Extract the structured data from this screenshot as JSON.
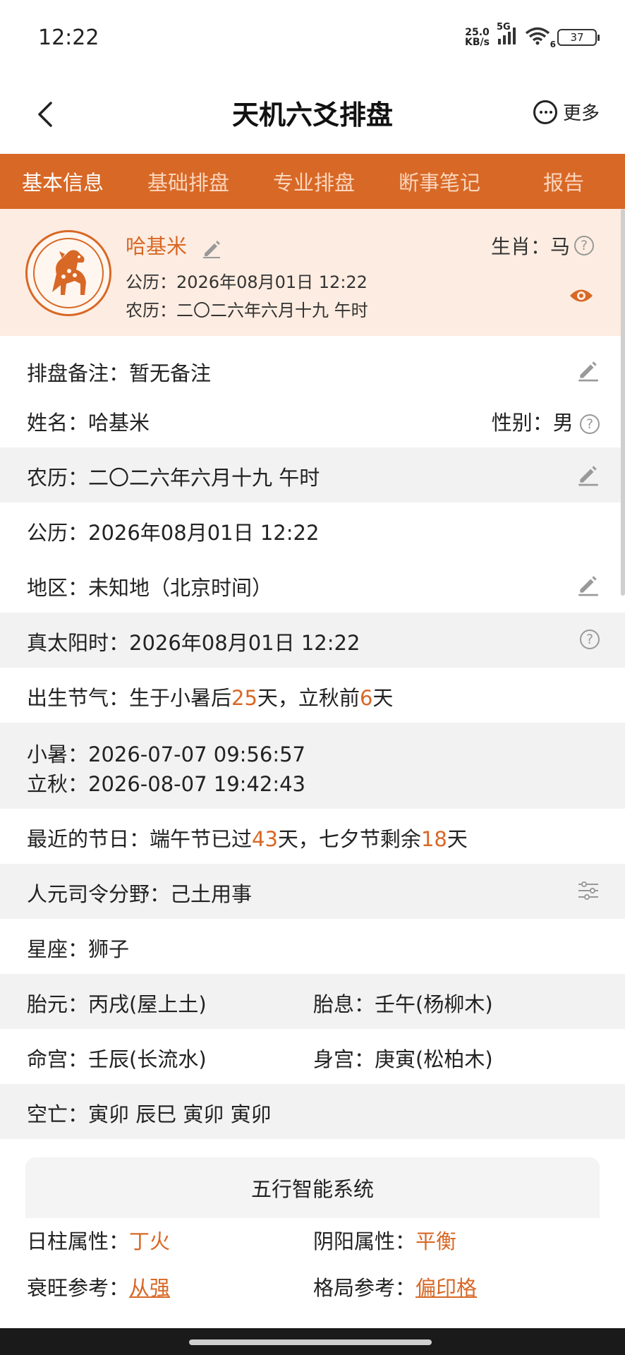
{
  "status": {
    "time": "12:22",
    "net_speed_top": "25.0",
    "net_speed_bottom": "KB/s",
    "network": "5G",
    "wifi_level": "6",
    "battery": "37"
  },
  "header": {
    "title": "天机六爻排盘",
    "more_label": "更多"
  },
  "tabs": [
    {
      "label": "基本信息",
      "active": true
    },
    {
      "label": "基础排盘",
      "active": false
    },
    {
      "label": "专业排盘",
      "active": false
    },
    {
      "label": "断事笔记",
      "active": false
    },
    {
      "label": "报告",
      "active": false
    }
  ],
  "profile": {
    "name": "哈基米",
    "gregorian": "公历：2026年08月01日 12:22",
    "lunar": "农历：二〇二六年六月十九  午时",
    "zodiac_label": "生肖：马"
  },
  "rows": {
    "remark": "排盘备注：暂无备注",
    "name": "姓名：哈基米",
    "gender": "性别：男",
    "lunar": "农历：二〇二六年六月十九  午时",
    "gregorian": "公历：2026年08月01日 12:22",
    "region": "地区：未知地（北京时间）",
    "solar_time": "真太阳时：2026年08月01日 12:22",
    "term_prefix": "出生节气：生于小暑后",
    "term_days_after": "25",
    "term_mid": "天，立秋前",
    "term_days_before": "6",
    "term_suffix": "天",
    "xiaoshu": "小暑：2026-07-07 09:56:57",
    "liqiu": "立秋：2026-08-07 19:42:43",
    "festival_prefix": "最近的节日：端午节已过",
    "festival_passed_days": "43",
    "festival_mid": "天，七夕节剩余",
    "festival_remaining_days": "18",
    "festival_suffix": "天",
    "renyuan": "人元司令分野：己土用事",
    "constellation": "星座：狮子",
    "taiyuan": "胎元：丙戌(屋上土)",
    "taixi": "胎息：壬午(杨柳木)",
    "minggong": "命宫：壬辰(长流水)",
    "shengong": "身宫：庚寅(松柏木)",
    "kongwang": "空亡：寅卯 辰巳 寅卯 寅卯"
  },
  "wuxing": {
    "title": "五行智能系统",
    "rizhu_label": "日柱属性：",
    "rizhu_value": "丁火",
    "yinyang_label": "阴阳属性：",
    "yinyang_value": "平衡",
    "shuaiwang_label": "衰旺参考：",
    "shuaiwang_value": "从强",
    "geju_label": "格局参考：",
    "geju_value": "偏印格"
  },
  "colors": {
    "accent": "#d86826",
    "profile_bg": "#fdece1"
  }
}
